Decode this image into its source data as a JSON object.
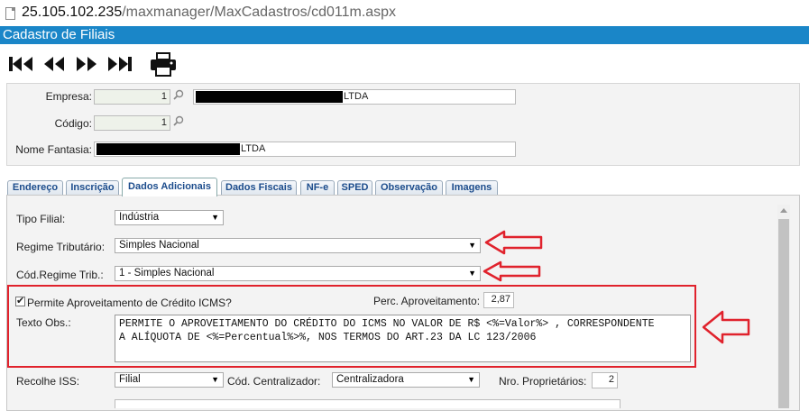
{
  "browser": {
    "url_host": "25.105.102.235",
    "url_path": "/maxmanager/MaxCadastros/cd011m.aspx"
  },
  "window": {
    "title": "Cadastro de Filiais"
  },
  "toolbar": {
    "icons": [
      "first-record-icon",
      "previous-record-icon",
      "next-record-icon",
      "last-record-icon",
      "print-icon"
    ]
  },
  "header": {
    "empresa_label": "Empresa:",
    "empresa_code": "1",
    "empresa_name_suffix": "LTDA",
    "codigo_label": "Código:",
    "codigo_value": "1",
    "nome_fantasia_label": "Nome Fantasia:",
    "nome_fantasia_suffix": "LTDA"
  },
  "tabs": [
    {
      "label": "Endereço"
    },
    {
      "label": "Inscrição"
    },
    {
      "label": "Dados Adicionais"
    },
    {
      "label": "Dados Fiscais"
    },
    {
      "label": "NF-e"
    },
    {
      "label": "SPED"
    },
    {
      "label": "Observação"
    },
    {
      "label": "Imagens"
    }
  ],
  "active_tab": "Dados Adicionais",
  "form": {
    "tipo_filial_label": "Tipo Filial:",
    "tipo_filial_value": "Indústria",
    "regime_label": "Regime Tributário:",
    "regime_value": "Simples Nacional",
    "cod_regime_label": "Cód.Regime Trib.:",
    "cod_regime_value": "1 - Simples Nacional",
    "permite_label": "Permite Aproveitamento de Crédito ICMS?",
    "permite_checked": true,
    "perc_label": "Perc. Aproveitamento:",
    "perc_value": "2,87",
    "texto_obs_label": "Texto Obs.:",
    "texto_obs_value": "PERMITE O APROVEITAMENTO DO CRÉDITO DO ICMS NO VALOR DE R$ <%=Valor%> , CORRESPONDENTE\nA ALÍQUOTA DE <%=Percentual%>%, NOS TERMOS DO ART.23 DA LC 123/2006",
    "recolhe_iss_label": "Recolhe ISS:",
    "recolhe_iss_value": "Filial",
    "cod_centralizador_label": "Cód. Centralizador:",
    "cod_centralizador_value": "Centralizadora",
    "nro_proprietarios_label": "Nro. Proprietários:",
    "nro_proprietarios_value": "2"
  },
  "annotation_color": "#e0222c",
  "accent_color": "#1a86c8"
}
